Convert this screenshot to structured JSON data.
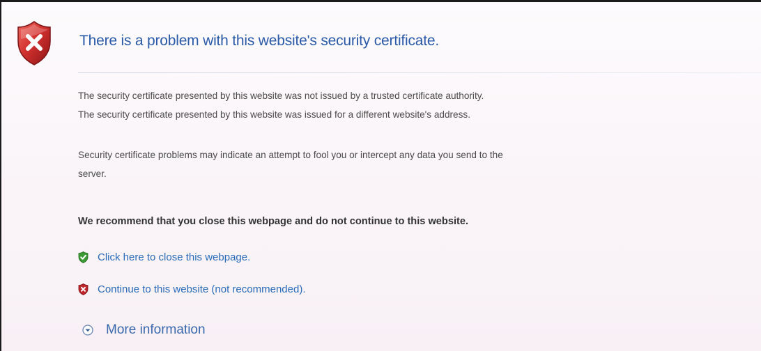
{
  "header": {
    "title": "There is a problem with this website's security certificate."
  },
  "messages": {
    "line1": "The security certificate presented by this website was not issued by a trusted certificate authority.",
    "line2": "The security certificate presented by this website was issued for a different website's address.",
    "warning_line1": "Security certificate problems may indicate an attempt to fool you or intercept any data you send to the",
    "warning_line2": "server."
  },
  "recommendation": "We recommend that you close this webpage and do not continue to this website.",
  "actions": {
    "close_label": "Click here to close this webpage.",
    "close_icon": "green-shield-check-icon",
    "continue_label": "Continue to this website (not recommended).",
    "continue_icon": "red-shield-x-icon"
  },
  "more_info": {
    "label": "More information",
    "icon": "expand-chevron-circle-icon"
  },
  "colors": {
    "title": "#2a5aa8",
    "link": "#2a6bb8",
    "body_text": "#4a4a4a",
    "shield_red": "#c0262c",
    "shield_green": "#3c9a34"
  }
}
